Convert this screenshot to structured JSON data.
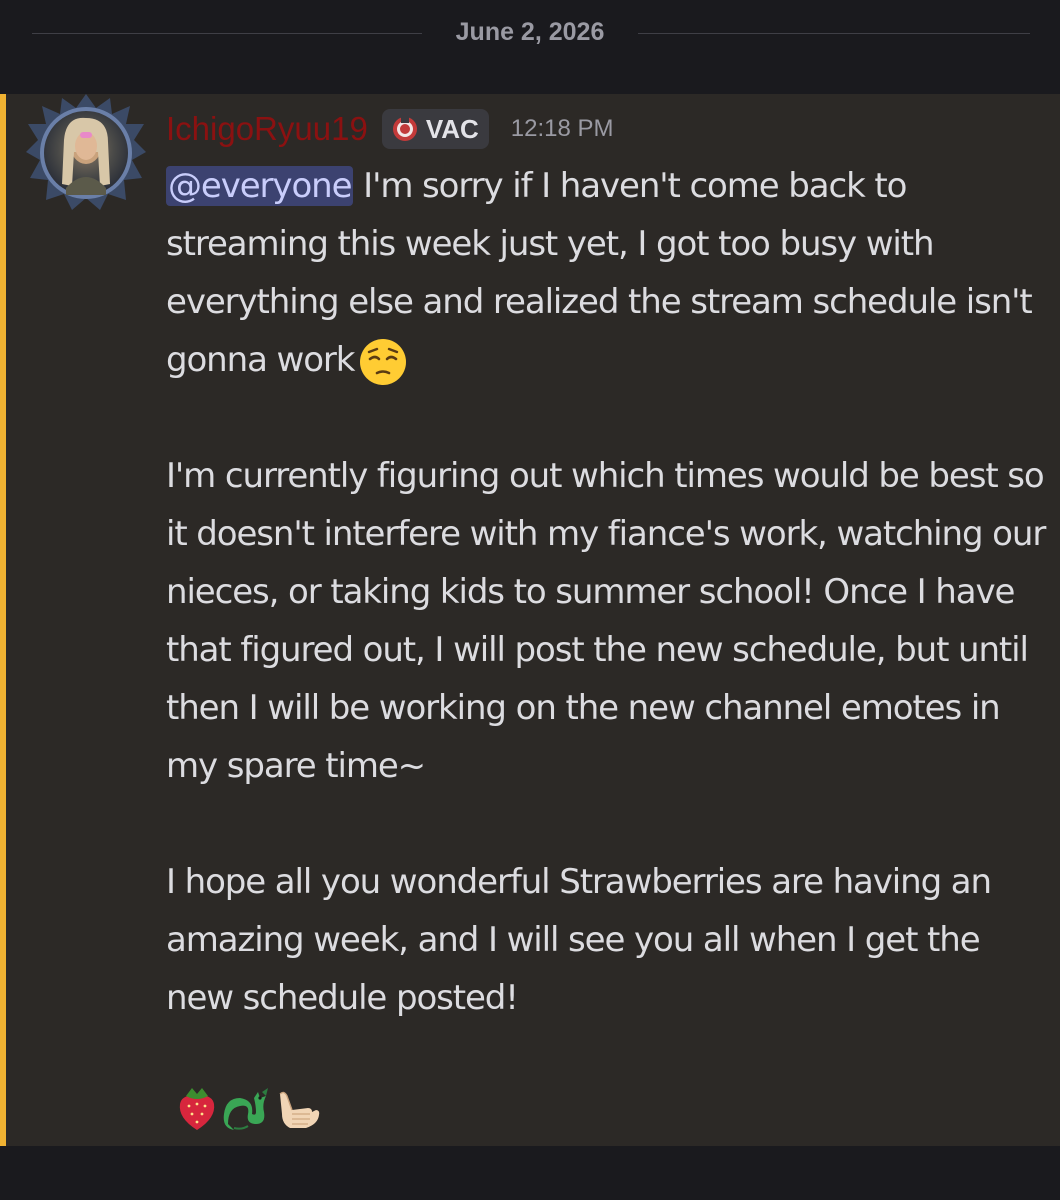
{
  "divider": {
    "date": "June 2, 2026"
  },
  "message": {
    "author": "IchigoRyuu19",
    "tag": "VAC",
    "time": "12:18 PM",
    "mention": "@everyone",
    "paragraph1_rest": " I'm sorry if I haven't come back to streaming this week just yet, I got too busy with everything else and realized the stream schedule isn't gonna work",
    "paragraph2": "I'm currently figuring out which times would be best so it doesn't interfere with my fiance's work, watching our nieces, or taking kids to summer school! Once I have that figured out, I will post the new schedule, but until then I will be working on the new channel emotes in my spare time~",
    "paragraph3": "I hope all you wonderful Strawberries are having an amazing week, and I will see you all when I get the new schedule posted!",
    "inline_emoji": "pensive-face-emoji",
    "closing_emojis": [
      "strawberry-emoji",
      "dragon-emoji",
      "call-me-hand-emoji"
    ]
  },
  "colors": {
    "accent_bar": "#f0b232",
    "username": "#8b1111",
    "mention_bg": "#3c4270",
    "message_bg": "#2c2926"
  }
}
